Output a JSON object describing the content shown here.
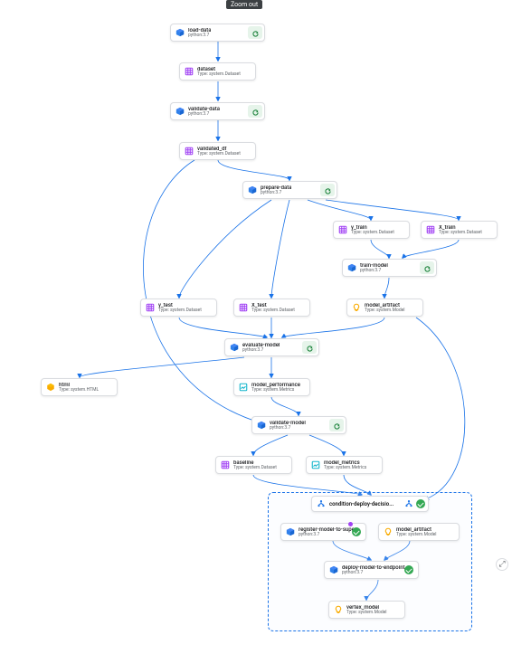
{
  "ui": {
    "zoom_out": "Zoom out",
    "expand_symbol": "⤢"
  },
  "nodes": {
    "load_data": {
      "title": "load-data",
      "sub": "python:3.7"
    },
    "dataset": {
      "title": "dataset",
      "sub": "Type: system.Dataset"
    },
    "validate_data": {
      "title": "validate-data",
      "sub": "python:3.7"
    },
    "validated_df": {
      "title": "validated_df",
      "sub": "Type: system.Dataset"
    },
    "prepare_data": {
      "title": "prepare-data",
      "sub": "python:3.7"
    },
    "y_train": {
      "title": "y_train",
      "sub": "Type: system.Dataset"
    },
    "x_train": {
      "title": "X_train",
      "sub": "Type: system.Dataset"
    },
    "train_model": {
      "title": "train-model",
      "sub": "python:3.7"
    },
    "y_test": {
      "title": "y_test",
      "sub": "Type: system.Dataset"
    },
    "x_test": {
      "title": "X_test",
      "sub": "Type: system.Dataset"
    },
    "model_artifact": {
      "title": "model_artifact",
      "sub": "Type: system.Model"
    },
    "evaluate_model": {
      "title": "evaluate-model",
      "sub": "python:3.7"
    },
    "html": {
      "title": "html",
      "sub": "Type: system.HTML"
    },
    "model_performance": {
      "title": "model_performance",
      "sub": "Type: system.Metrics"
    },
    "validate_model": {
      "title": "validate-model",
      "sub": "python:3.7"
    },
    "baseline": {
      "title": "baseline",
      "sub": "Type: system.Dataset"
    },
    "model_metrics": {
      "title": "model_metrics",
      "sub": "Type: system.Metrics"
    },
    "condition": {
      "title": "condition-deploy-decisio..."
    },
    "register_model": {
      "title": "register-model-to-super...",
      "sub": "python:3.7"
    },
    "model_artifact2": {
      "title": "model_artifact",
      "sub": "Type: system.Model"
    },
    "deploy_model": {
      "title": "deploy-model-to-endpoint",
      "sub": "python:3.7"
    },
    "vertex_model": {
      "title": "vertex_model",
      "sub": "Type: system.Model"
    }
  },
  "chart_data": {
    "type": "dag",
    "nodes": [
      {
        "id": "load_data",
        "kind": "task",
        "runtime": "python:3.7"
      },
      {
        "id": "dataset",
        "kind": "artifact",
        "artifact_type": "system.Dataset"
      },
      {
        "id": "validate_data",
        "kind": "task",
        "runtime": "python:3.7"
      },
      {
        "id": "validated_df",
        "kind": "artifact",
        "artifact_type": "system.Dataset"
      },
      {
        "id": "prepare_data",
        "kind": "task",
        "runtime": "python:3.7"
      },
      {
        "id": "y_train",
        "kind": "artifact",
        "artifact_type": "system.Dataset"
      },
      {
        "id": "x_train",
        "kind": "artifact",
        "artifact_type": "system.Dataset"
      },
      {
        "id": "train_model",
        "kind": "task",
        "runtime": "python:3.7"
      },
      {
        "id": "y_test",
        "kind": "artifact",
        "artifact_type": "system.Dataset"
      },
      {
        "id": "x_test",
        "kind": "artifact",
        "artifact_type": "system.Dataset"
      },
      {
        "id": "model_artifact",
        "kind": "artifact",
        "artifact_type": "system.Model"
      },
      {
        "id": "evaluate_model",
        "kind": "task",
        "runtime": "python:3.7"
      },
      {
        "id": "html",
        "kind": "artifact",
        "artifact_type": "system.HTML"
      },
      {
        "id": "model_performance",
        "kind": "artifact",
        "artifact_type": "system.Metrics"
      },
      {
        "id": "validate_model",
        "kind": "task",
        "runtime": "python:3.7"
      },
      {
        "id": "baseline",
        "kind": "artifact",
        "artifact_type": "system.Dataset"
      },
      {
        "id": "model_metrics",
        "kind": "artifact",
        "artifact_type": "system.Metrics"
      },
      {
        "id": "condition",
        "kind": "condition",
        "label": "condition-deploy-decision",
        "status": "success"
      },
      {
        "id": "register_model",
        "kind": "task",
        "runtime": "python:3.7",
        "status": "success"
      },
      {
        "id": "model_artifact2",
        "kind": "artifact",
        "artifact_type": "system.Model"
      },
      {
        "id": "deploy_model",
        "kind": "task",
        "runtime": "python:3.7",
        "status": "success"
      },
      {
        "id": "vertex_model",
        "kind": "artifact",
        "artifact_type": "system.Model"
      }
    ],
    "edges": [
      [
        "load_data",
        "dataset"
      ],
      [
        "dataset",
        "validate_data"
      ],
      [
        "validate_data",
        "validated_df"
      ],
      [
        "validated_df",
        "prepare_data"
      ],
      [
        "prepare_data",
        "y_train"
      ],
      [
        "prepare_data",
        "x_train"
      ],
      [
        "prepare_data",
        "y_test"
      ],
      [
        "prepare_data",
        "x_test"
      ],
      [
        "y_train",
        "train_model"
      ],
      [
        "x_train",
        "train_model"
      ],
      [
        "train_model",
        "model_artifact"
      ],
      [
        "y_test",
        "evaluate_model"
      ],
      [
        "x_test",
        "evaluate_model"
      ],
      [
        "model_artifact",
        "evaluate_model"
      ],
      [
        "evaluate_model",
        "html"
      ],
      [
        "evaluate_model",
        "model_performance"
      ],
      [
        "model_performance",
        "validate_model"
      ],
      [
        "validated_df",
        "validate_model"
      ],
      [
        "validate_model",
        "baseline"
      ],
      [
        "validate_model",
        "model_metrics"
      ],
      [
        "baseline",
        "condition"
      ],
      [
        "model_metrics",
        "condition"
      ],
      [
        "model_artifact",
        "condition"
      ],
      [
        "register_model",
        "model_artifact2"
      ],
      [
        "register_model",
        "deploy_model"
      ],
      [
        "model_artifact2",
        "deploy_model"
      ],
      [
        "deploy_model",
        "vertex_model"
      ]
    ]
  }
}
